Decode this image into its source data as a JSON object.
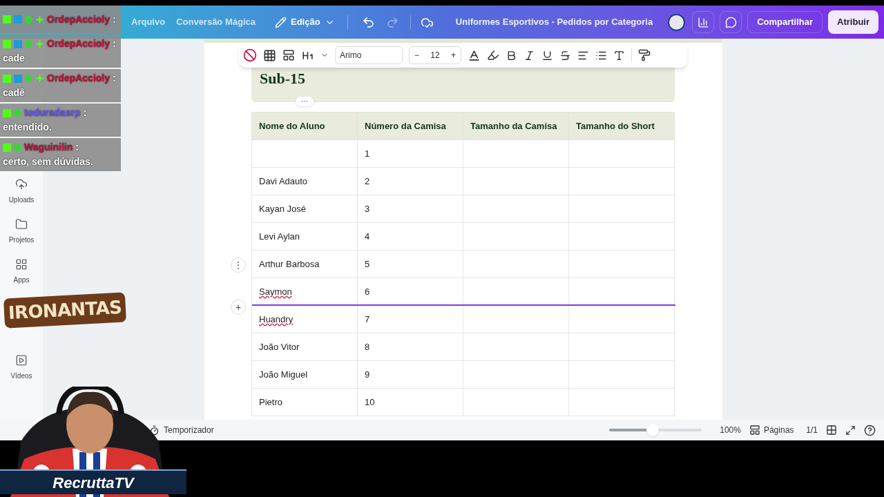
{
  "header": {
    "menu": [
      "Arquivo",
      "Conversão Mágica"
    ],
    "edit_menu": "Edição",
    "title": "Uniformes Esportivos - Pedidos por Categoria",
    "share": "Compartilhar",
    "assign": "Atribuir"
  },
  "sidebar": {
    "items": [
      {
        "label": "Uploads",
        "kind": "upload"
      },
      {
        "label": "Projetos",
        "kind": "folder"
      },
      {
        "label": "Apps",
        "kind": "apps"
      },
      {
        "label": "Vídeos",
        "kind": "video"
      }
    ]
  },
  "toolbar": {
    "font": "Arimo",
    "minus": "−",
    "size": "12",
    "plus": "+"
  },
  "heading": {
    "text": "Sub-15",
    "more": "···"
  },
  "table": {
    "columns": [
      "Nome do Aluno",
      "Número da Camisa",
      "Tamanho da Camisa",
      "Tamanho do Short"
    ],
    "rows": [
      {
        "name": "",
        "number": "1",
        "insert_below": false
      },
      {
        "name": "Davi Adauto",
        "number": "2",
        "spellcheck": false,
        "insert_below": false
      },
      {
        "name": "Kayan José",
        "number": "3",
        "spellcheck": false,
        "insert_below": false
      },
      {
        "name": "Levi Aylan",
        "number": "4",
        "spellcheck": false,
        "insert_below": false
      },
      {
        "name": "Arthur Barbosa",
        "number": "5",
        "spellcheck": false,
        "insert_below": false
      },
      {
        "name": "Saymon",
        "number": "6",
        "spellcheck": true,
        "insert_below": true
      },
      {
        "name": "Huandry",
        "number": "7",
        "spellcheck": true,
        "insert_below": false
      },
      {
        "name": "João Vitor",
        "number": "8",
        "spellcheck": false,
        "insert_below": false
      },
      {
        "name": "João Miguel",
        "number": "9",
        "spellcheck": false,
        "insert_below": false
      },
      {
        "name": "Pietro",
        "number": "10",
        "spellcheck": false,
        "insert_below": false
      }
    ],
    "row_handle": "⋮",
    "add_row": "+"
  },
  "status_bar": {
    "timer": "Temporizador",
    "zoom": {
      "level": 0.47
    },
    "zoom_text": "100%",
    "pages": "Páginas",
    "page_count": "1/1"
  },
  "chat": [
    {
      "user": "OrdepAccioly",
      "color": "#c8103a",
      "sep": ":",
      "badges": [
        {
          "kind": "k"
        },
        {
          "kind": "tool"
        },
        {
          "kind": "check"
        },
        {
          "kind": "star"
        }
      ]
    },
    {
      "user": "OrdepAccioly",
      "color": "#c8103a",
      "sep": ":",
      "text": "cade",
      "badges": [
        {
          "kind": "k"
        },
        {
          "kind": "tool"
        },
        {
          "kind": "check"
        },
        {
          "kind": "star"
        }
      ]
    },
    {
      "user": "OrdepAccioly",
      "color": "#c8103a",
      "sep": ":",
      "text": "cadê",
      "badges": [
        {
          "kind": "k"
        },
        {
          "kind": "tool"
        },
        {
          "kind": "check"
        },
        {
          "kind": "star"
        }
      ]
    },
    {
      "user": "toduradasrp",
      "color": "#6a5cff",
      "sep": ":",
      "text": "entendido.",
      "badges": [
        {
          "kind": "k"
        },
        {
          "kind": "check"
        }
      ]
    },
    {
      "user": "Waguinilin",
      "color": "#c8103a",
      "sep": ":",
      "text": "certo, sem dúvidas.",
      "badges": [
        {
          "kind": "k"
        },
        {
          "kind": "check"
        }
      ]
    }
  ],
  "overlay": {
    "logo": "IRONANTAS",
    "banner": "RecruttaTV"
  }
}
